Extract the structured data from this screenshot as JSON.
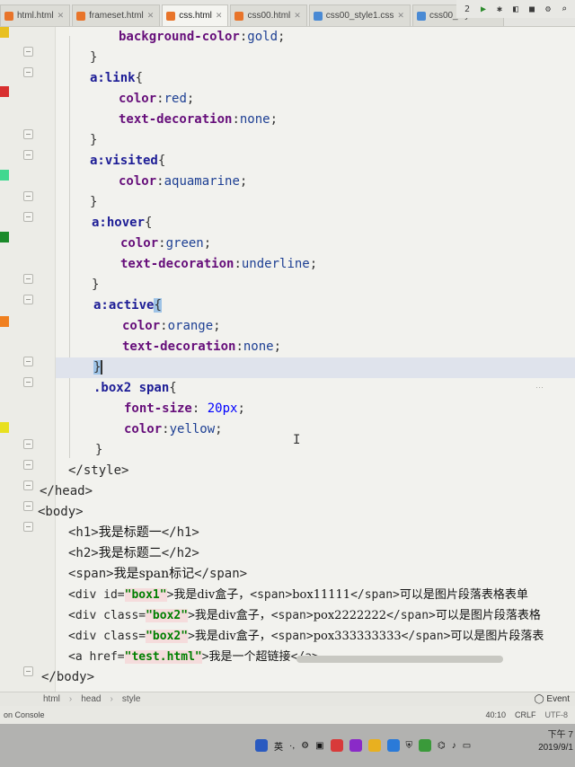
{
  "tabs": [
    {
      "label": "html.html",
      "icon_color": "#e8742a",
      "active": false
    },
    {
      "label": "frameset.html",
      "icon_color": "#e8742a",
      "active": false
    },
    {
      "label": "css.html",
      "icon_color": "#e8742a",
      "active": true
    },
    {
      "label": "css00.html",
      "icon_color": "#e8742a",
      "active": false
    },
    {
      "label": "css00_style1.css",
      "icon_color": "#4a8ad4",
      "active": false
    },
    {
      "label": "css00_style0.css",
      "icon_color": "#4a8ad4",
      "active": false
    }
  ],
  "toolbar": {
    "run_icon": "play-icon",
    "debug_icon": "bug-icon",
    "search_icon": "search-icon",
    "config_label": "2"
  },
  "code": {
    "l1": {
      "prop": "background-color",
      "val": "gold"
    },
    "l2": {
      "brace": "}"
    },
    "l3": {
      "sel": "a:link",
      "open": "{"
    },
    "l4": {
      "prop": "color",
      "val": "red"
    },
    "l5": {
      "prop": "text-decoration",
      "val": "none"
    },
    "l6": {
      "brace": "}"
    },
    "l7": {
      "sel": "a:visited",
      "open": "{"
    },
    "l8": {
      "prop": "color",
      "val": "aquamarine"
    },
    "l9": {
      "brace": "}"
    },
    "l10": {
      "sel": "a:hover",
      "open": "{"
    },
    "l11": {
      "prop": "color",
      "val": "green"
    },
    "l12": {
      "prop": "text-decoration",
      "val": "underline"
    },
    "l13": {
      "brace": "}"
    },
    "l14": {
      "sel": "a:active",
      "open": "{"
    },
    "l15": {
      "prop": "color",
      "val": "orange"
    },
    "l16": {
      "prop": "text-decoration",
      "val": "none"
    },
    "l17": {
      "brace": "}"
    },
    "l18": {
      "sel": ".box2 span",
      "open": "{"
    },
    "l19": {
      "prop": "font-size",
      "val": "20px"
    },
    "l20": {
      "prop": "color",
      "val": "yellow"
    },
    "l21": {
      "brace": "}"
    },
    "l22": {
      "tag": "</style>"
    },
    "l23": {
      "tag": "</head>"
    },
    "l24": {
      "tag": "<body>"
    },
    "l25": {
      "open": "<h1>",
      "text": "我是标题一",
      "close": "</h1>"
    },
    "l26": {
      "open": "<h2>",
      "text": "我是标题二",
      "close": "</h2>"
    },
    "l27": {
      "open": "<span>",
      "text": "我是span标记",
      "close": "</span>"
    },
    "l28": {
      "a": "<div id=",
      "s": "\"box1\"",
      "b": ">",
      "t1": "我是div盒子，",
      "c": "<span>",
      "t2": "box11111",
      "d": "</span>",
      "t3": "可以是图片段落表格表单"
    },
    "l29": {
      "a": "<div class=",
      "s": "\"box2\"",
      "b": ">",
      "t1": "我是div盒子，",
      "c": "<span>",
      "t2": "pox2222222",
      "d": "</span>",
      "t3": "可以是图片段落表格"
    },
    "l30": {
      "a": "<div class=",
      "s": "\"box2\"",
      "b": ">",
      "t1": "我是div盒子，",
      "c": "<span>",
      "t2": "pox333333333",
      "d": "</span>",
      "t3": "可以是图片段落表"
    },
    "l31": {
      "a": "<a href=",
      "s": "\"test.html\"",
      "b": ">",
      "t1": "我是一个超链接",
      "c": "</a>"
    },
    "l32": {
      "tag": "</body>"
    }
  },
  "gutter_marks": [
    {
      "color": "#e8c020"
    },
    {
      "color": "#d83030"
    },
    {
      "color": "#40d890"
    },
    {
      "color": "#1a8a2a"
    },
    {
      "color": "#f08020"
    },
    {
      "color": "#e8e020"
    }
  ],
  "breadcrumb": {
    "items": [
      "html",
      "head",
      "style"
    ],
    "event_label": "Event"
  },
  "status": {
    "console_label": "on Console",
    "position": "40:10",
    "line_sep": "CRLF",
    "encoding": "UTF-8"
  },
  "clock": {
    "time": "下午 7",
    "date": "2019/9/1"
  }
}
